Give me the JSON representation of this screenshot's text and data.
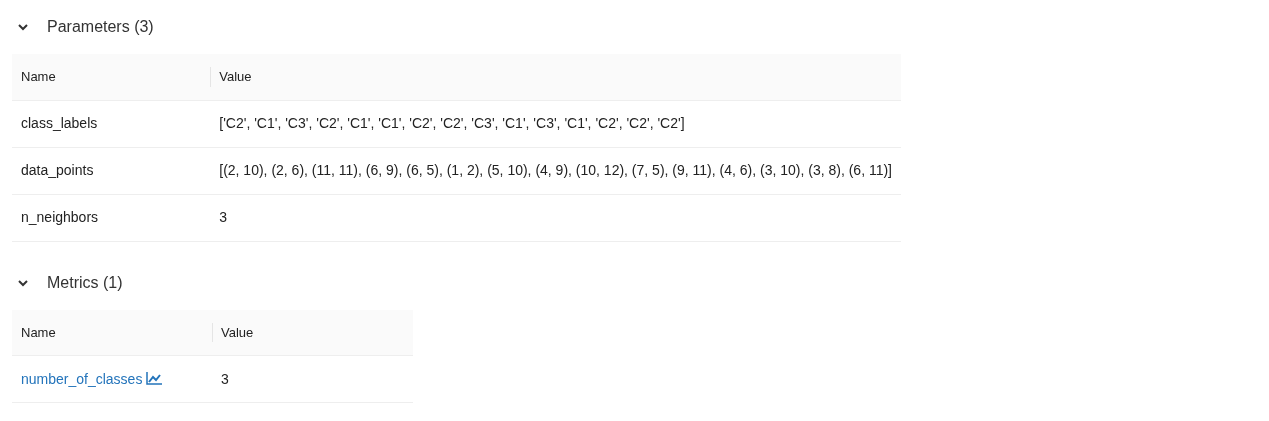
{
  "sections": [
    {
      "title": "Parameters (3)",
      "expanded": true,
      "columns": [
        "Name",
        "Value"
      ],
      "rows": [
        {
          "kind": "text",
          "name": "class_labels",
          "value": "['C2', 'C1', 'C3', 'C2', 'C1', 'C1', 'C2', 'C2', 'C3', 'C1', 'C3', 'C1', 'C2', 'C2', 'C2']"
        },
        {
          "kind": "text",
          "name": "data_points",
          "value": "[(2, 10), (2, 6), (11, 11), (6, 9), (6, 5), (1, 2), (5, 10), (4, 9), (10, 12), (7, 5), (9, 11), (4, 6), (3, 10), (3, 8), (6, 11)]"
        },
        {
          "kind": "text",
          "name": "n_neighbors",
          "value": "3"
        }
      ]
    },
    {
      "title": "Metrics (1)",
      "expanded": true,
      "columns": [
        "Name",
        "Value"
      ],
      "rows": [
        {
          "kind": "link",
          "name": "number_of_classes",
          "value": "3"
        }
      ]
    }
  ]
}
